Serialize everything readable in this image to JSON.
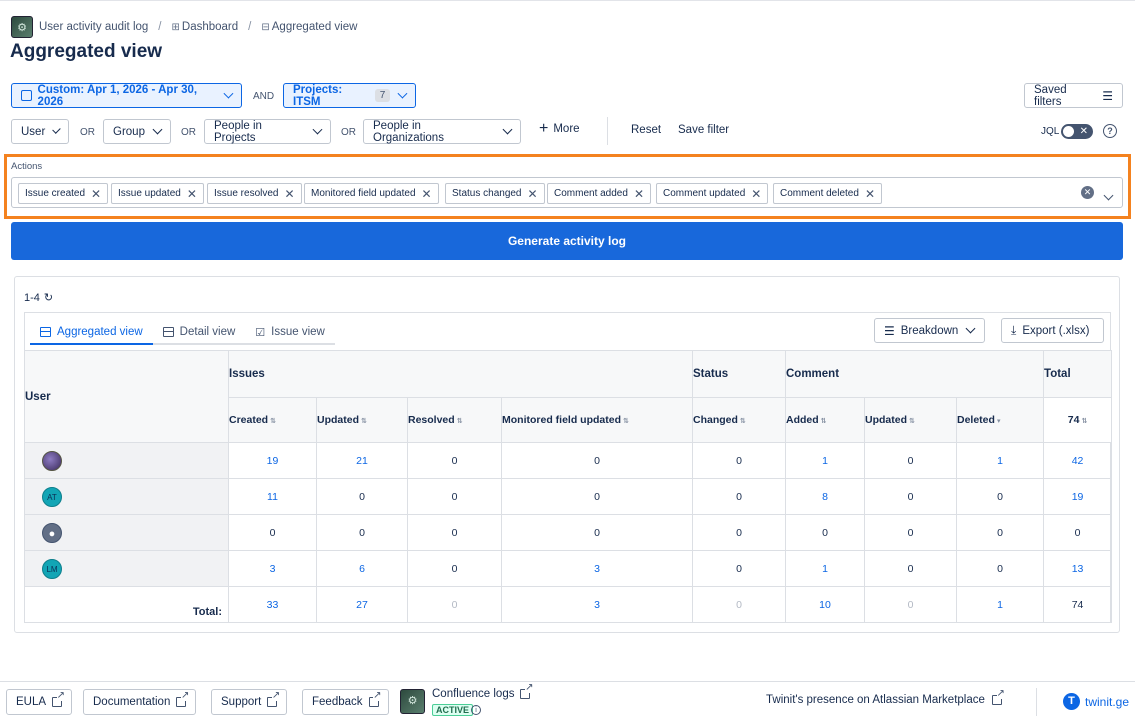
{
  "breadcrumb": {
    "app": "User activity audit log",
    "dashboard": "Dashboard",
    "current": "Aggregated view"
  },
  "page": {
    "title": "Aggregated view"
  },
  "filters": {
    "date": "Custom: Apr 1, 2026 - Apr 30, 2026",
    "and": "AND",
    "projects_label": "Projects: ITSM",
    "projects_count": "7",
    "saved_filters": "Saved filters",
    "user": "User",
    "group": "Group",
    "people_projects": "People in Projects",
    "people_orgs": "People in Organizations",
    "or": "OR",
    "more": "More",
    "reset": "Reset",
    "save_filter": "Save filter",
    "jql": "JQL"
  },
  "actions": {
    "label": "Actions",
    "tags": [
      "Issue created",
      "Issue updated",
      "Issue resolved",
      "Monitored field updated",
      "Status changed",
      "Comment added",
      "Comment updated",
      "Comment deleted"
    ]
  },
  "generate_button": "Generate activity log",
  "results": {
    "range": "1-4",
    "tabs": [
      "Aggregated view",
      "Detail view",
      "Issue view"
    ],
    "breakdown": "Breakdown",
    "export": "Export (.xlsx)"
  },
  "table": {
    "user_header": "User",
    "groups": {
      "issues": "Issues",
      "status": "Status",
      "comment": "Comment",
      "total": "Total"
    },
    "columns": [
      "Created",
      "Updated",
      "Resolved",
      "Monitored field updated",
      "Changed",
      "Added",
      "Updated",
      "Deleted"
    ],
    "total_header_value": "74",
    "rows": [
      {
        "initials": "",
        "values": [
          "19",
          "21",
          "0",
          "0",
          "0",
          "1",
          "0",
          "1"
        ],
        "total": "42"
      },
      {
        "initials": "AT",
        "values": [
          "11",
          "0",
          "0",
          "0",
          "0",
          "8",
          "0",
          "0"
        ],
        "total": "19"
      },
      {
        "initials": "",
        "values": [
          "0",
          "0",
          "0",
          "0",
          "0",
          "0",
          "0",
          "0"
        ],
        "total": "0"
      },
      {
        "initials": "LM",
        "values": [
          "3",
          "6",
          "0",
          "3",
          "0",
          "1",
          "0",
          "0"
        ],
        "total": "13"
      }
    ],
    "totals_label": "Total:",
    "totals": [
      "33",
      "27",
      "0",
      "3",
      "0",
      "10",
      "0",
      "1"
    ],
    "grand_total": "74"
  },
  "footer": {
    "eula": "EULA",
    "documentation": "Documentation",
    "support": "Support",
    "feedback": "Feedback",
    "confluence": "Confluence logs",
    "active": "ACTIVE",
    "marketplace": "Twinit's presence on Atlassian Marketplace",
    "twinit": "twinit.ge"
  },
  "colors": {
    "accent": "#0c66e4",
    "primary_button": "#1868db",
    "highlight_frame": "#f4821f"
  }
}
